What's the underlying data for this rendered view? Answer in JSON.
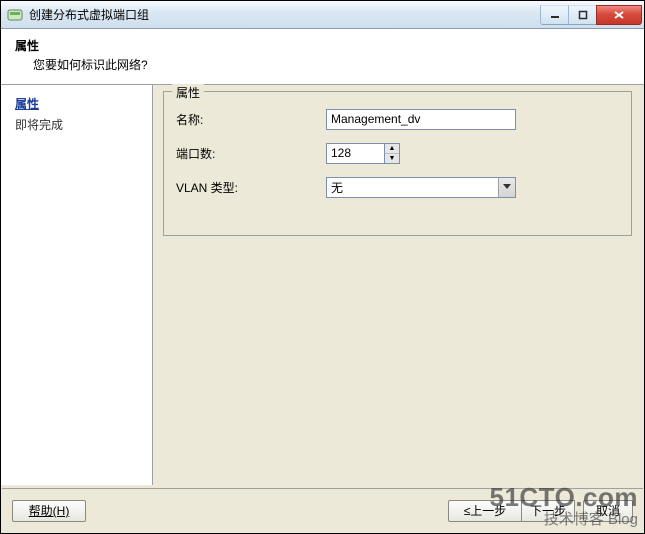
{
  "window": {
    "title": "创建分布式虚拟端口组"
  },
  "header": {
    "title": "属性",
    "subtitle": "您要如何标识此网络?"
  },
  "steps": {
    "active": "属性",
    "item1": "即将完成"
  },
  "group": {
    "legend": "属性",
    "name_label": "名称:",
    "name_value": "Management_dv",
    "ports_label": "端口数:",
    "ports_value": "128",
    "vlan_label": "VLAN 类型:",
    "vlan_value": "无"
  },
  "footer": {
    "help": "帮助(H)",
    "back": "≤上一步",
    "next": "下一步",
    "cancel": "取消"
  },
  "watermark": {
    "main": "51CTO.com",
    "sub": "技术博客   Blog"
  }
}
